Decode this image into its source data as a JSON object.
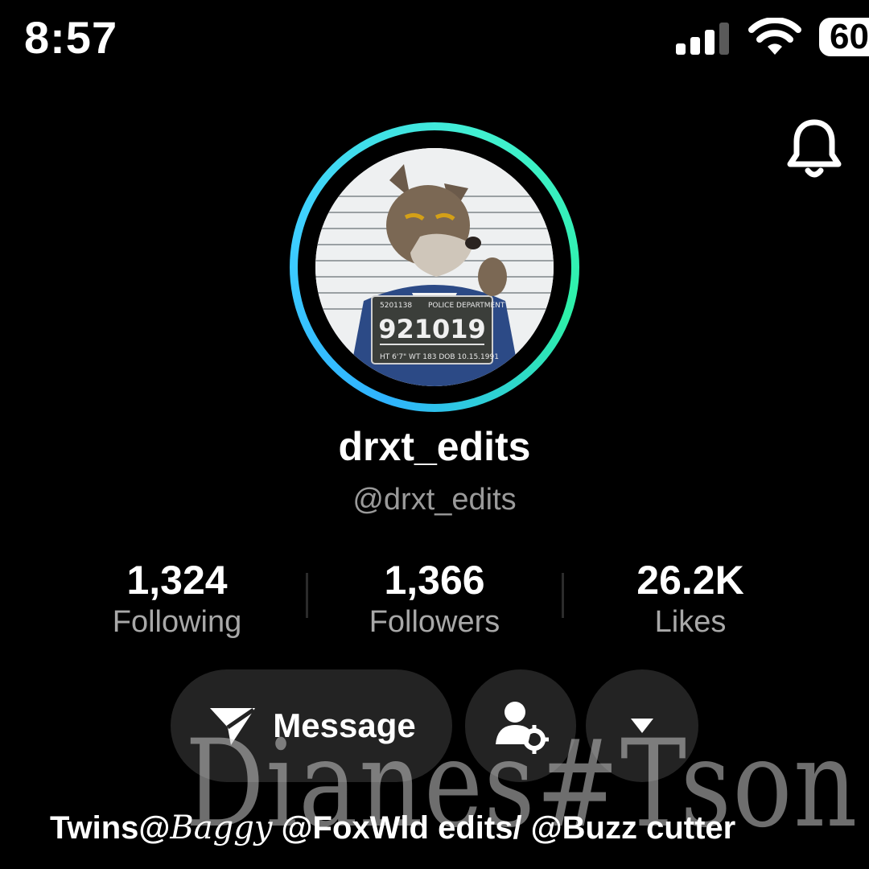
{
  "status_bar": {
    "time": "8:57",
    "battery": "60"
  },
  "profile": {
    "display_name": "drxt_edits",
    "handle": "@drxt_edits",
    "avatar_badge_number": "921019",
    "avatar_badge_header_left": "5201138",
    "avatar_badge_header_right": "POLICE DEPARTMENT",
    "avatar_badge_footer": "HT 6'7\" WT 183   DOB 10.15.1991"
  },
  "stats": [
    {
      "value": "1,324",
      "label": "Following"
    },
    {
      "value": "1,366",
      "label": "Followers"
    },
    {
      "value": "26.2K",
      "label": "Likes"
    }
  ],
  "actions": {
    "message_label": "Message"
  },
  "watermark": "Dianes#Tson",
  "bio": {
    "line1_a": "Twins@",
    "line1_script": "Baggy",
    "line1_b": " @FoxWld edits/ @Buzz cutter"
  },
  "colors": {
    "ring_start": "#2fb3ff",
    "ring_end": "#2df0a8",
    "button_bg": "#232323",
    "secondary_text": "#9a9a9a"
  }
}
